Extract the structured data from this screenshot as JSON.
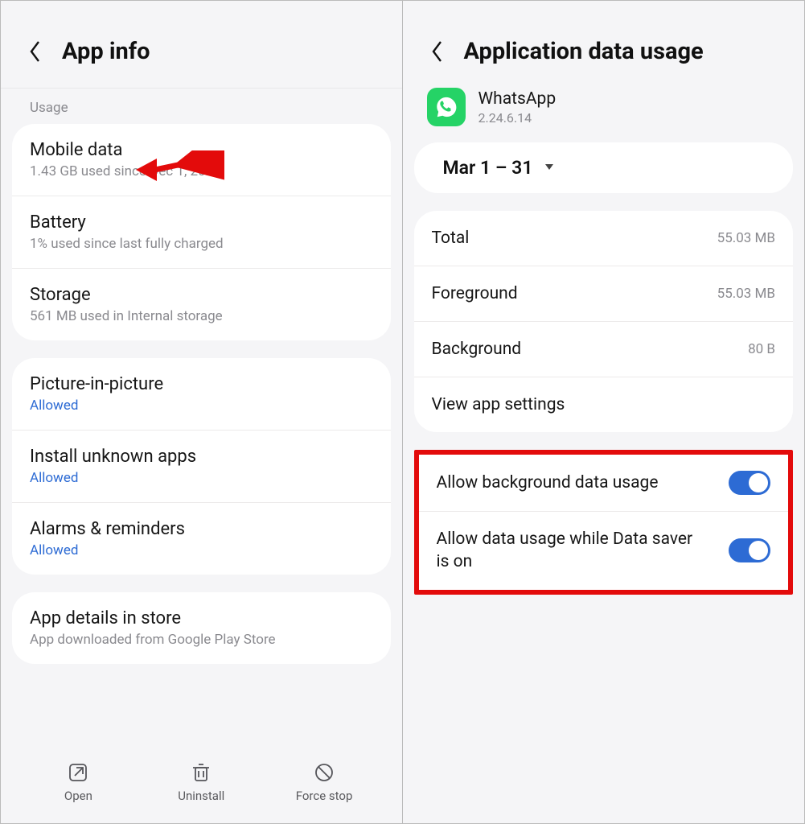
{
  "left": {
    "title": "App info",
    "sectionLabel": "Usage",
    "rows1": [
      {
        "title": "Mobile data",
        "sub": "1.43 GB used since Dec 1, 2023"
      },
      {
        "title": "Battery",
        "sub": "1% used since last fully charged"
      },
      {
        "title": "Storage",
        "sub": "561 MB used in Internal storage"
      }
    ],
    "rows2": [
      {
        "title": "Picture-in-picture",
        "link": "Allowed"
      },
      {
        "title": "Install unknown apps",
        "link": "Allowed"
      },
      {
        "title": "Alarms & reminders",
        "link": "Allowed"
      }
    ],
    "rows3": [
      {
        "title": "App details in store",
        "sub": "App downloaded from Google Play Store"
      }
    ],
    "bottom": {
      "open": "Open",
      "uninstall": "Uninstall",
      "forcestop": "Force stop"
    }
  },
  "right": {
    "title": "Application data usage",
    "app": {
      "name": "WhatsApp",
      "version": "2.24.6.14"
    },
    "dateRange": "Mar 1 – 31",
    "stats": [
      {
        "label": "Total",
        "value": "55.03 MB"
      },
      {
        "label": "Foreground",
        "value": "55.03 MB"
      },
      {
        "label": "Background",
        "value": "80 B"
      }
    ],
    "viewSettings": "View app settings",
    "toggles": [
      {
        "label": "Allow background data usage",
        "on": true
      },
      {
        "label": "Allow data usage while Data saver is on",
        "on": true
      }
    ]
  }
}
